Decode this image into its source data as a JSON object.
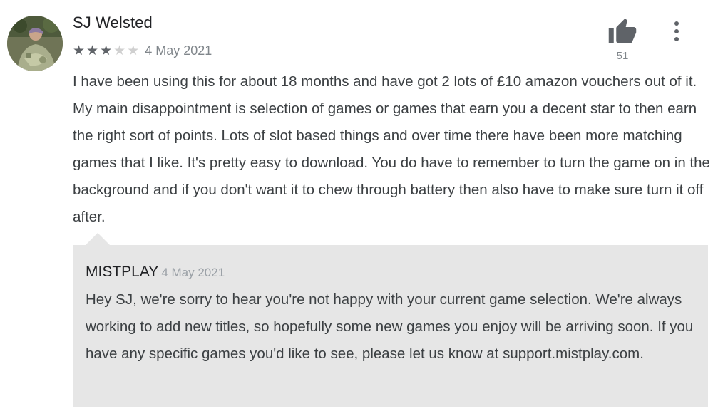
{
  "review": {
    "author": "SJ Welsted",
    "rating": 3,
    "max_rating": 5,
    "date": "4 May 2021",
    "helpful_count": "51",
    "body": "I have been using this for about 18 months and have got 2 lots of £10 amazon vouchers out of it. My main disappointment is selection of games or games that earn you a decent star to then earn the right sort of points. Lots of slot based things and over time there have been more matching games that I like. It's pretty easy to download. You do have to remember to turn the game on in the background and if you don't want it to chew through battery then also have to make sure turn it off after."
  },
  "reply": {
    "developer": "MISTPLAY",
    "date": "4 May 2021",
    "body": "Hey SJ, we're sorry to hear you're not happy with your current game selection. We're always working to add new titles, so hopefully some new games you enjoy will be arriving soon. If you have any specific games you'd like to see, please let us know at support.mistplay.com."
  },
  "icons": {
    "helpful": "thumbs-up-icon",
    "menu": "more-vert-icon",
    "star_filled": "star-filled-icon",
    "star_empty": "star-empty-icon"
  },
  "colors": {
    "star_filled": "#5f6368",
    "star_empty": "#d0d0d0",
    "reply_background": "#e6e6e6",
    "text": "#3c4043"
  }
}
